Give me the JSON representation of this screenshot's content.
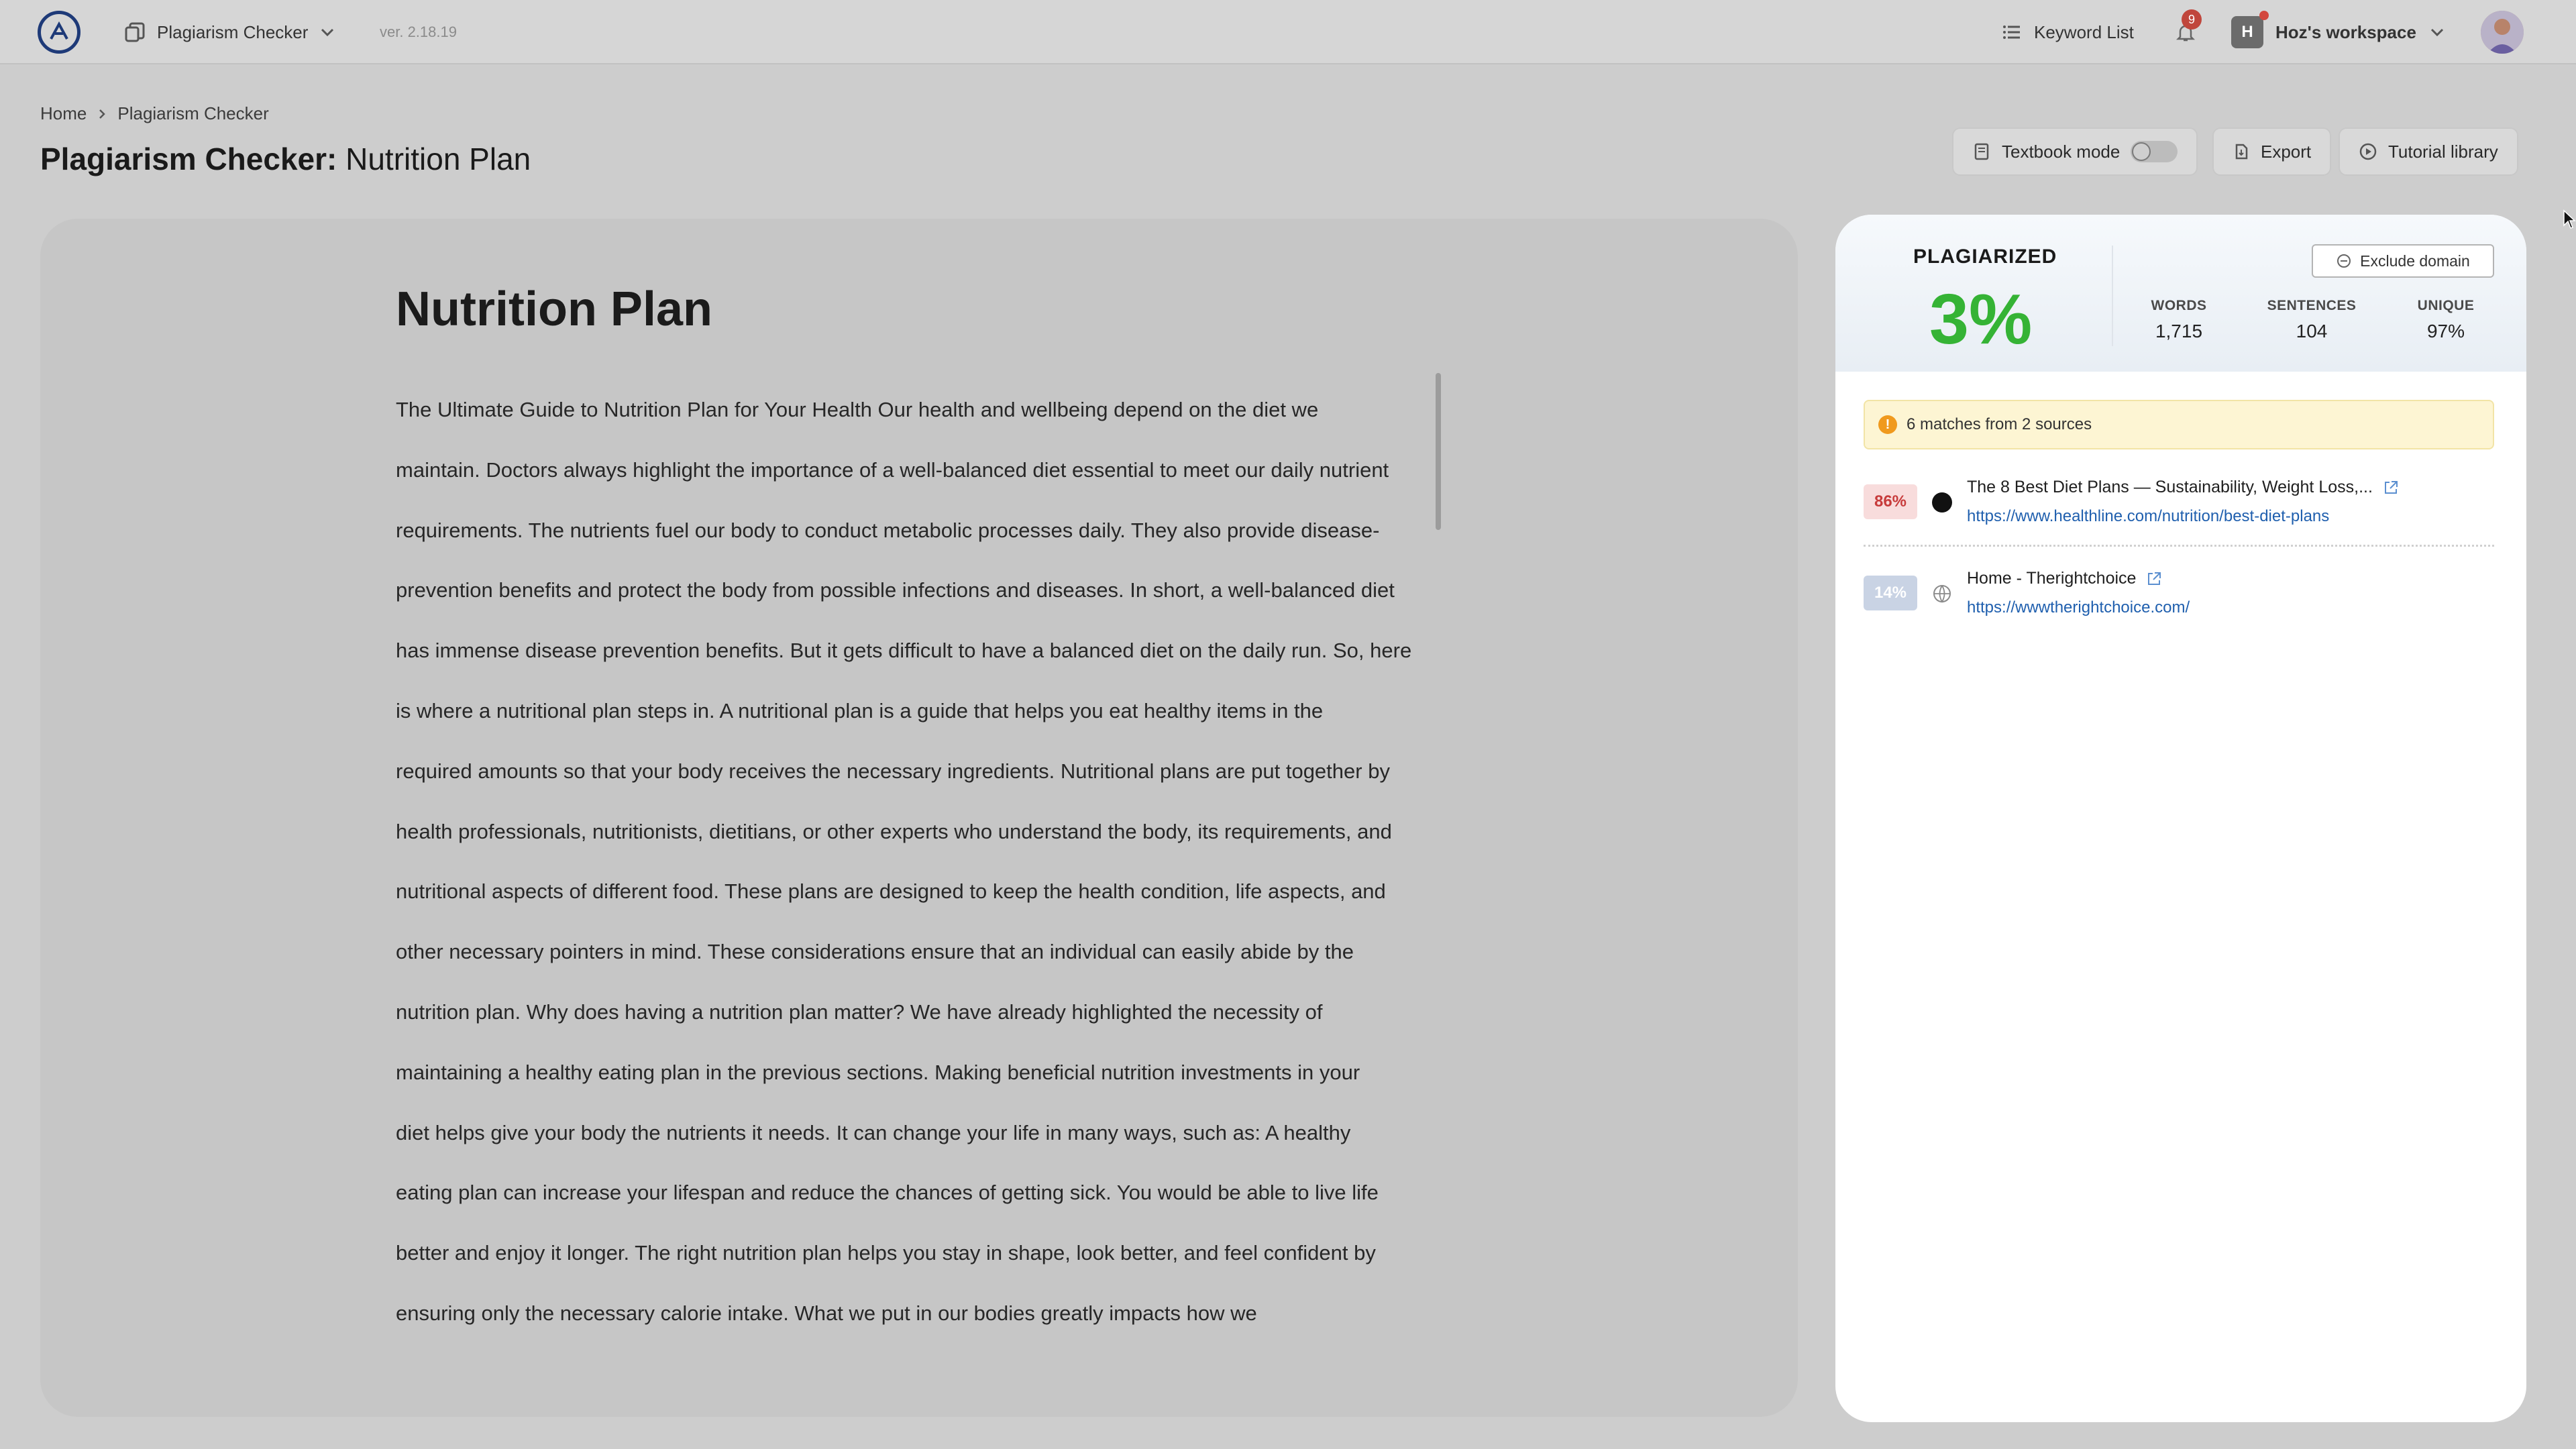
{
  "topbar": {
    "app_name": "Plagiarism Checker",
    "version": "ver. 2.18.19",
    "keyword_list": "Keyword List",
    "notification_count": "9",
    "workspace_initial": "H",
    "workspace_name": "Hoz's workspace"
  },
  "breadcrumb": {
    "home": "Home",
    "current": "Plagiarism Checker"
  },
  "page": {
    "title_bold": "Plagiarism Checker:",
    "title_rest": "Nutrition Plan"
  },
  "toolbar": {
    "textbook_mode": "Textbook mode",
    "textbook_mode_on": false,
    "export": "Export",
    "tutorial": "Tutorial library"
  },
  "document": {
    "title": "Nutrition Plan",
    "lines": [
      "The Ultimate Guide to Nutrition Plan for Your Health Our health and wellbeing depend on the diet we",
      "maintain. Doctors always highlight the importance of a well-balanced diet essential to meet our daily nutrient",
      "requirements. The nutrients fuel our body to conduct metabolic processes daily. They also provide disease-",
      "prevention benefits and protect the body from possible infections and diseases. In short, a well-balanced diet",
      "has immense disease prevention benefits. But it gets difficult to have a balanced diet on the daily run. So, here",
      "is where a nutritional plan steps in. A nutritional plan is a guide that helps you eat healthy items in the",
      "required amounts so that your body receives the necessary ingredients. Nutritional plans are put together by",
      "health professionals, nutritionists, dietitians, or other experts who understand the body, its requirements, and",
      "nutritional aspects of different food. These plans are designed to keep the health condition, life aspects, and",
      "other necessary pointers in mind. These considerations ensure that an individual can easily abide by the",
      "nutrition plan. Why does having a nutrition plan matter? We have already highlighted the necessity of",
      "maintaining a healthy eating plan in the previous sections. Making beneficial nutrition investments in your",
      "diet helps give your body the nutrients it needs. It can change your life in many ways, such as: A healthy",
      "eating plan can increase your lifespan and reduce the chances of getting sick. You would be able to live life",
      "better and enjoy it longer. The right nutrition plan helps you stay in shape, look better, and feel confident by",
      "ensuring only the necessary calorie intake. What we put in our bodies greatly impacts how we"
    ]
  },
  "results": {
    "plagiarized_label": "PLAGIARIZED",
    "plagiarized_value": "3%",
    "words_label": "WORDS",
    "words_value": "1,715",
    "sentences_label": "SENTENCES",
    "sentences_value": "104",
    "unique_label": "UNIQUE",
    "unique_value": "97%",
    "exclude_domain": "Exclude domain",
    "matches_summary": "6 matches from 2 sources",
    "sources": [
      {
        "percent": "86%",
        "title": "The 8 Best Diet Plans — Sustainability, Weight Loss,...",
        "url": "https://www.healthline.com/nutrition/best-diet-plans"
      },
      {
        "percent": "14%",
        "title": "Home - Therightchoice",
        "url": "https://wwwtherightchoice.com/"
      }
    ]
  },
  "colors": {
    "plagiarized_green": "#35b335",
    "source_86_bg": "#f8dcdc",
    "source_86_text": "#c73b3b",
    "source_14_bg": "#c9d3e4",
    "link_blue": "#1f5fae"
  },
  "icons": [
    "app-logo-icon",
    "plagiarism-checker-icon",
    "chevron-down-icon",
    "list-icon",
    "bell-icon",
    "chevron-right-icon",
    "book-icon",
    "export-icon",
    "play-circle-icon",
    "minus-circle-icon",
    "warning-icon",
    "external-link-icon",
    "globe-icon"
  ]
}
